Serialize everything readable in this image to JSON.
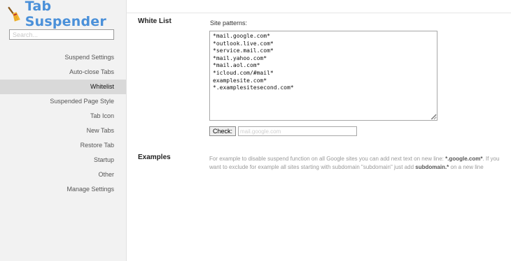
{
  "app": {
    "title": "Tab Suspender",
    "logo_icon": "broom-icon",
    "accent_color": "#4a90d9"
  },
  "search": {
    "placeholder": "Search...",
    "value": ""
  },
  "sidebar": {
    "items": [
      {
        "label": "Suspend Settings",
        "active": false
      },
      {
        "label": "Auto-close Tabs",
        "active": false
      },
      {
        "label": "Whitelist",
        "active": true
      },
      {
        "label": "Suspended Page Style",
        "active": false
      },
      {
        "label": "Tab Icon",
        "active": false
      },
      {
        "label": "New Tabs",
        "active": false
      },
      {
        "label": "Restore Tab",
        "active": false
      },
      {
        "label": "Startup",
        "active": false
      },
      {
        "label": "Other",
        "active": false
      },
      {
        "label": "Manage Settings",
        "active": false
      }
    ]
  },
  "whitelist": {
    "title": "White List",
    "patterns_label": "Site patterns:",
    "patterns": [
      "*mail.google.com*",
      "*outlook.live.com*",
      "*service.mail.com*",
      "*mail.yahoo.com*",
      "*mail.aol.com*",
      "*icloud.com/#mail*",
      "examplesite.com*",
      "*.examplesitesecond.com*"
    ],
    "check_button": "Check:",
    "check_placeholder": "mail.google.com"
  },
  "examples": {
    "title": "Examples",
    "part1": "For example to disable suspend function on all Google sites you can add next text on new line: ",
    "bold1": "*.google.com*",
    "part2": ". If you want to exclude for example all sites starting with subdomain \"subdomain\" just add ",
    "bold2": "subdomain.*",
    "part3": " on a new line"
  }
}
